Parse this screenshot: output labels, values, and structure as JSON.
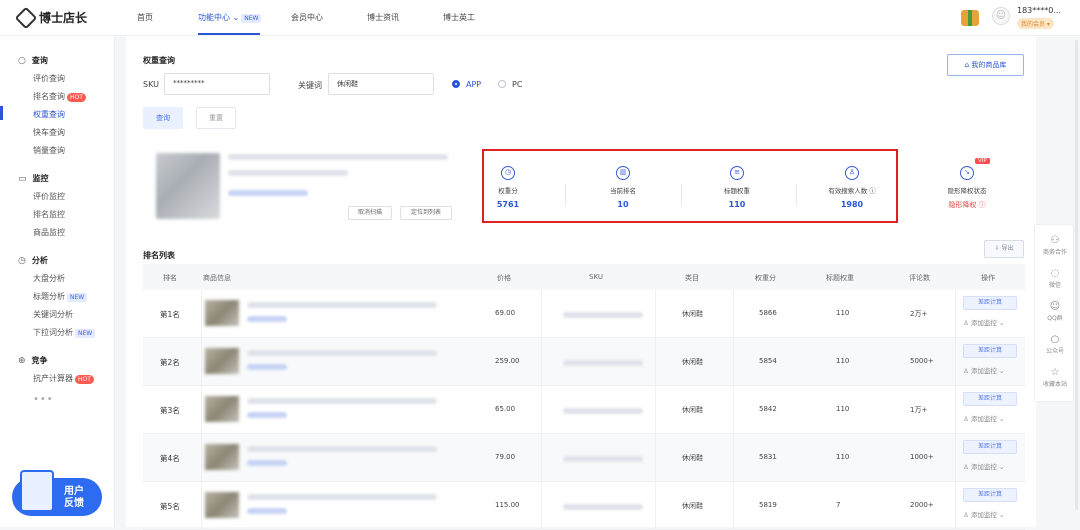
{
  "brand": {
    "name": "博士店长"
  },
  "nav": {
    "home": "首页",
    "feature": "功能中心",
    "feature_badge": "NEW",
    "member": "会员中心",
    "news": "博士资讯",
    "worker": "博士英工"
  },
  "user": {
    "phone": "183****0...",
    "vip": "我的会员"
  },
  "sidebar": {
    "query": {
      "title": "查询",
      "items": [
        "评价查询",
        "排名查询",
        "权重查询",
        "快车查询",
        "销量查询"
      ],
      "hot": "HOT"
    },
    "monitor": {
      "title": "监控",
      "items": [
        "评价监控",
        "排名监控",
        "商品监控"
      ]
    },
    "analysis": {
      "title": "分析",
      "items": [
        "大盘分析",
        "标题分析",
        "关键词分析",
        "下拉词分析"
      ],
      "new": "NEW"
    },
    "compete": {
      "title": "竞争",
      "items": [
        "抗产计算器"
      ],
      "hot": "HOT"
    },
    "more": "•••",
    "feedback": {
      "line1": "用户",
      "line2": "反馈"
    }
  },
  "weight_query": {
    "title": "权重查询",
    "sku_label": "SKU",
    "sku_value": "*********",
    "keyword_label": "关键词",
    "keyword_value": "休闲鞋",
    "radio_app": "APP",
    "radio_pc": "PC",
    "query_btn": "查询",
    "reset_btn": "重置",
    "my_products_btn": "我的商品库"
  },
  "product": {
    "btn_cancel": "取消扫描",
    "btn_locate": "定位到列表"
  },
  "metrics": [
    {
      "label": "权重分",
      "value": "5761"
    },
    {
      "label": "当前排名",
      "value": "10"
    },
    {
      "label": "标题权重",
      "value": "110"
    },
    {
      "label": "有效搜索人数",
      "value": "1980"
    }
  ],
  "hidden_status": {
    "label": "隐形降权状态",
    "value": "隐形降权",
    "vip": "VIP"
  },
  "ranking": {
    "title": "排名列表",
    "export": "导出",
    "headers": [
      "排名",
      "商品信息",
      "价格",
      "SKU",
      "类目",
      "权重分",
      "标题权重",
      "评论数",
      "操作"
    ],
    "rows": [
      {
        "rank": "第1名",
        "price": "69.00",
        "category": "休闲鞋",
        "weight": "5866",
        "title_w": "110",
        "comments": "2万+"
      },
      {
        "rank": "第2名",
        "price": "259.00",
        "category": "休闲鞋",
        "weight": "5854",
        "title_w": "110",
        "comments": "5000+"
      },
      {
        "rank": "第3名",
        "price": "65.00",
        "category": "休闲鞋",
        "weight": "5842",
        "title_w": "110",
        "comments": "1万+"
      },
      {
        "rank": "第4名",
        "price": "79.00",
        "category": "休闲鞋",
        "weight": "5831",
        "title_w": "110",
        "comments": "1000+"
      },
      {
        "rank": "第5名",
        "price": "115.00",
        "category": "休闲鞋",
        "weight": "5819",
        "title_w": "7",
        "comments": "2000+"
      }
    ],
    "calc_btn": "差距计算",
    "add_monitor": "添加监控"
  },
  "right_tools": [
    "商务合作",
    "微信",
    "QQ群",
    "公众号",
    "收藏本站"
  ]
}
